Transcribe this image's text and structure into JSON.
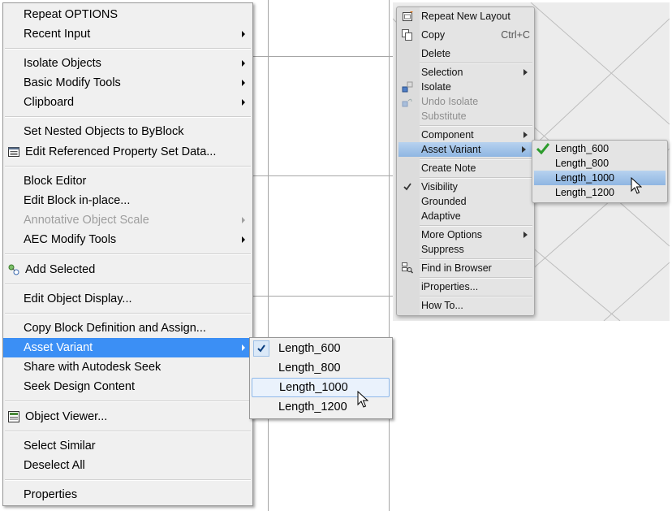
{
  "left_menu": {
    "items": [
      {
        "label": "Repeat OPTIONS"
      },
      {
        "label": "Recent Input"
      },
      {
        "label": "Isolate Objects"
      },
      {
        "label": "Basic Modify Tools"
      },
      {
        "label": "Clipboard"
      },
      {
        "label": "Set Nested Objects to ByBlock"
      },
      {
        "label": "Edit Referenced Property Set Data..."
      },
      {
        "label": "Block Editor"
      },
      {
        "label": "Edit Block in-place..."
      },
      {
        "label": "Annotative Object Scale"
      },
      {
        "label": "AEC Modify Tools"
      },
      {
        "label": "Add Selected"
      },
      {
        "label": "Edit Object Display..."
      },
      {
        "label": "Copy Block Definition and Assign..."
      },
      {
        "label": "Asset Variant"
      },
      {
        "label": "Share with Autodesk Seek"
      },
      {
        "label": "Seek Design Content"
      },
      {
        "label": "Object Viewer..."
      },
      {
        "label": "Select Similar"
      },
      {
        "label": "Deselect All"
      },
      {
        "label": "Properties"
      }
    ],
    "submenu": [
      "Length_600",
      "Length_800",
      "Length_1000",
      "Length_1200"
    ]
  },
  "right_menu": {
    "items": [
      {
        "label": "Repeat New Layout"
      },
      {
        "label": "Copy",
        "accel": "Ctrl+C"
      },
      {
        "label": "Delete"
      },
      {
        "label": "Selection"
      },
      {
        "label": "Isolate"
      },
      {
        "label": "Undo Isolate"
      },
      {
        "label": "Substitute"
      },
      {
        "label": "Component"
      },
      {
        "label": "Asset Variant"
      },
      {
        "label": "Create Note"
      },
      {
        "label": "Visibility"
      },
      {
        "label": "Grounded"
      },
      {
        "label": "Adaptive"
      },
      {
        "label": "More Options"
      },
      {
        "label": "Suppress"
      },
      {
        "label": "Find in Browser"
      },
      {
        "label": "iProperties..."
      },
      {
        "label": "How To..."
      }
    ],
    "submenu": [
      "Length_600",
      "Length_800",
      "Length_1000",
      "Length_1200"
    ]
  },
  "colors": {
    "highlight_blue": "#3b8ff5",
    "check_green": "#2c9b2c"
  }
}
